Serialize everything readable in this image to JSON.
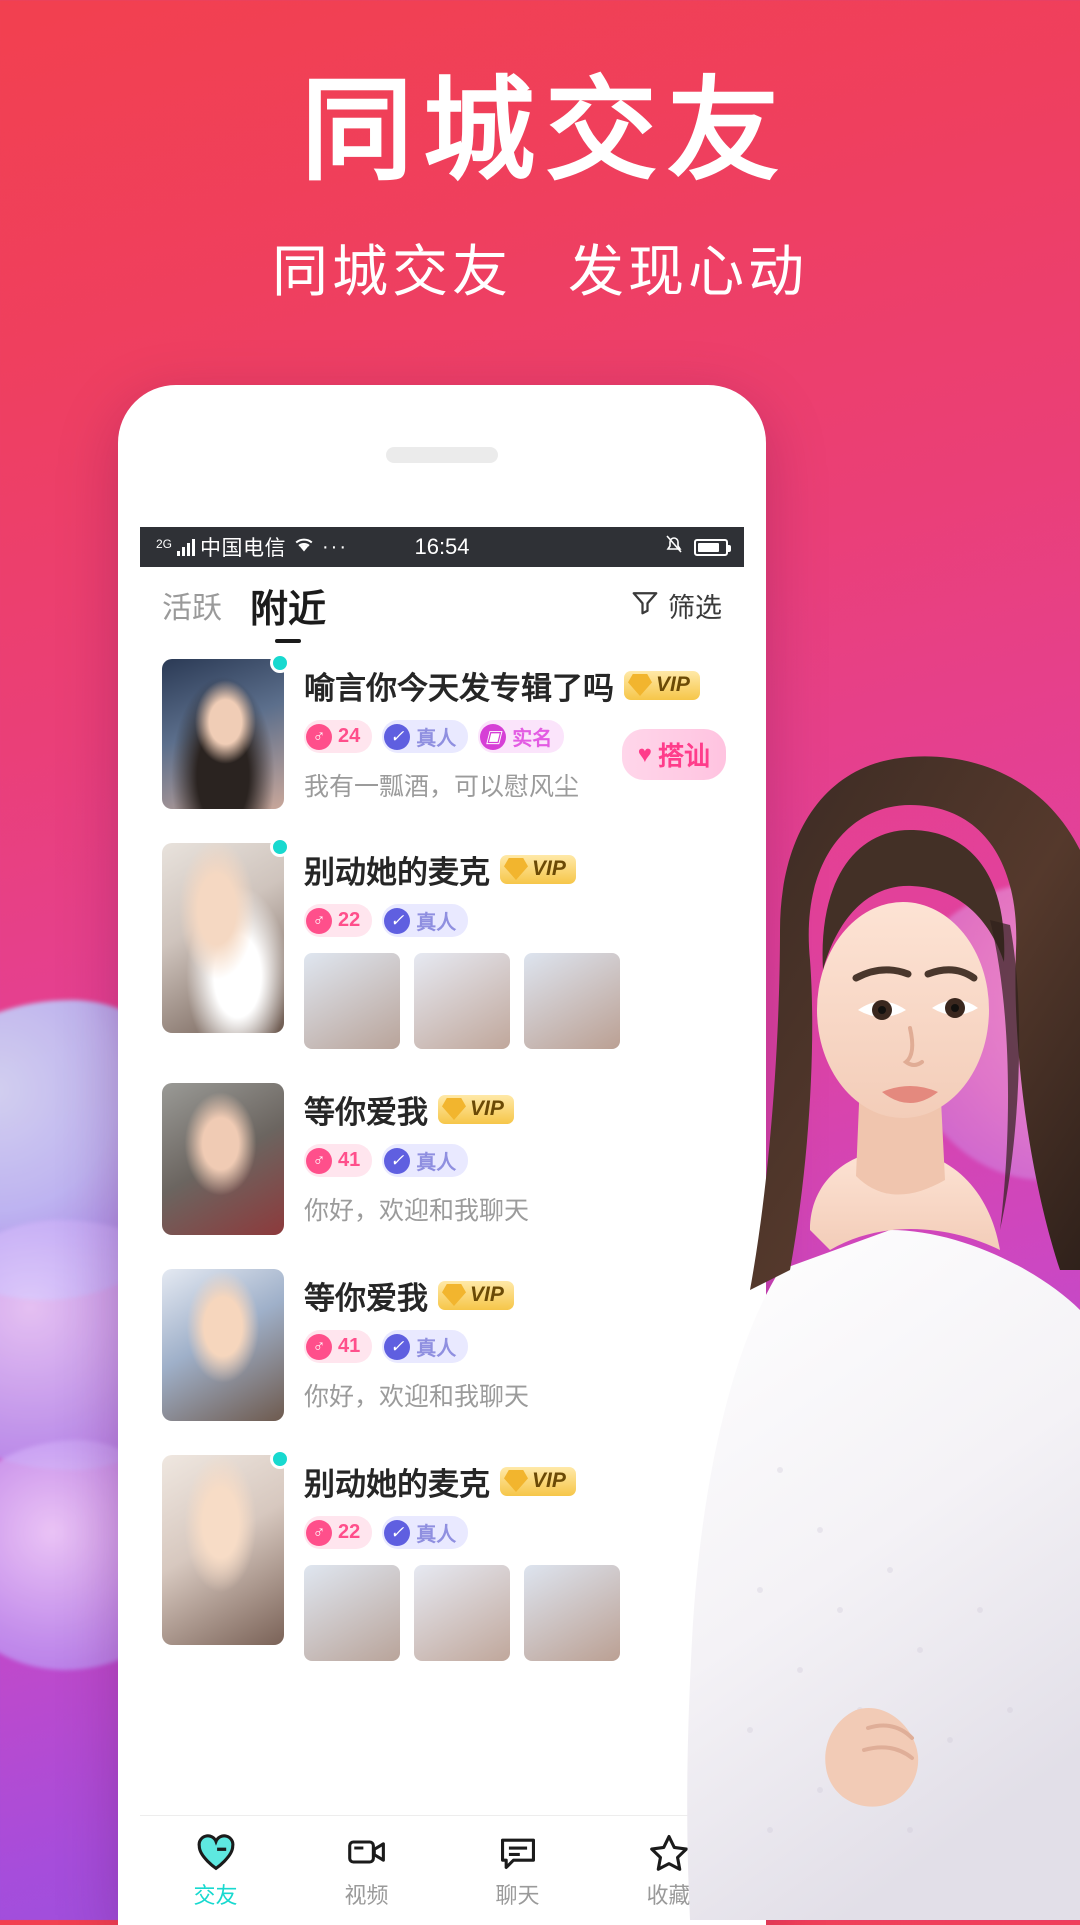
{
  "promo": {
    "headline": "同城交友",
    "subtitle_left": "同城交友",
    "subtitle_right": "发现心动"
  },
  "colors": {
    "bg_top": "#f2404f",
    "bg_bottom": "#8a52e0",
    "accent_pink": "#ff4f8b",
    "accent_teal": "#18d9cf",
    "vip_gold": "#f6c649"
  },
  "phone": {
    "statusbar": {
      "network_type": "2G",
      "carrier": "中国电信",
      "dots": "···",
      "time": "16:54",
      "wifi_icon": "wifi-icon",
      "signal_icon": "signal-bars-icon",
      "bell_icon": "bell-mute-icon",
      "battery_icon": "battery-icon"
    },
    "nav": {
      "tabs": [
        {
          "label": "活跃",
          "active": false
        },
        {
          "label": "附近",
          "active": true
        }
      ],
      "filter_label": "筛选",
      "filter_icon": "filter-icon"
    },
    "list": [
      {
        "nickname": "喻言你今天发专辑了吗",
        "vip": "VIP",
        "online": true,
        "tags": [
          {
            "type": "age",
            "icon": "male-icon",
            "label": "24"
          },
          {
            "type": "real",
            "icon": "check-shield-icon",
            "label": "真人"
          },
          {
            "type": "name",
            "icon": "id-card-icon",
            "label": "实名"
          }
        ],
        "desc": "我有一瓢酒，可以慰风尘",
        "thumbs": 0,
        "greet": {
          "label": "搭讪",
          "icon": "heartbeat-icon"
        }
      },
      {
        "nickname": "别动她的麦克",
        "vip": "VIP",
        "online": true,
        "tags": [
          {
            "type": "age",
            "icon": "male-icon",
            "label": "22"
          },
          {
            "type": "real",
            "icon": "check-shield-icon",
            "label": "真人"
          }
        ],
        "desc": "",
        "thumbs": 3
      },
      {
        "nickname": "等你爱我",
        "vip": "VIP",
        "online": false,
        "tags": [
          {
            "type": "age",
            "icon": "male-icon",
            "label": "41"
          },
          {
            "type": "real",
            "icon": "check-shield-icon",
            "label": "真人"
          }
        ],
        "desc": "你好，欢迎和我聊天",
        "thumbs": 0
      },
      {
        "nickname": "等你爱我",
        "vip": "VIP",
        "online": false,
        "tags": [
          {
            "type": "age",
            "icon": "male-icon",
            "label": "41"
          },
          {
            "type": "real",
            "icon": "check-shield-icon",
            "label": "真人"
          }
        ],
        "desc": "你好，欢迎和我聊天",
        "thumbs": 0
      },
      {
        "nickname": "别动她的麦克",
        "vip": "VIP",
        "online": true,
        "tags": [
          {
            "type": "age",
            "icon": "male-icon",
            "label": "22"
          },
          {
            "type": "real",
            "icon": "check-shield-icon",
            "label": "真人"
          }
        ],
        "desc": "",
        "thumbs": 3
      }
    ],
    "bottombar": [
      {
        "label": "交友",
        "icon": "heart-icon",
        "active": true
      },
      {
        "label": "视频",
        "icon": "video-camera-icon",
        "active": false
      },
      {
        "label": "聊天",
        "icon": "chat-bubble-icon",
        "active": false
      },
      {
        "label": "收藏",
        "icon": "star-icon",
        "active": false
      }
    ]
  }
}
